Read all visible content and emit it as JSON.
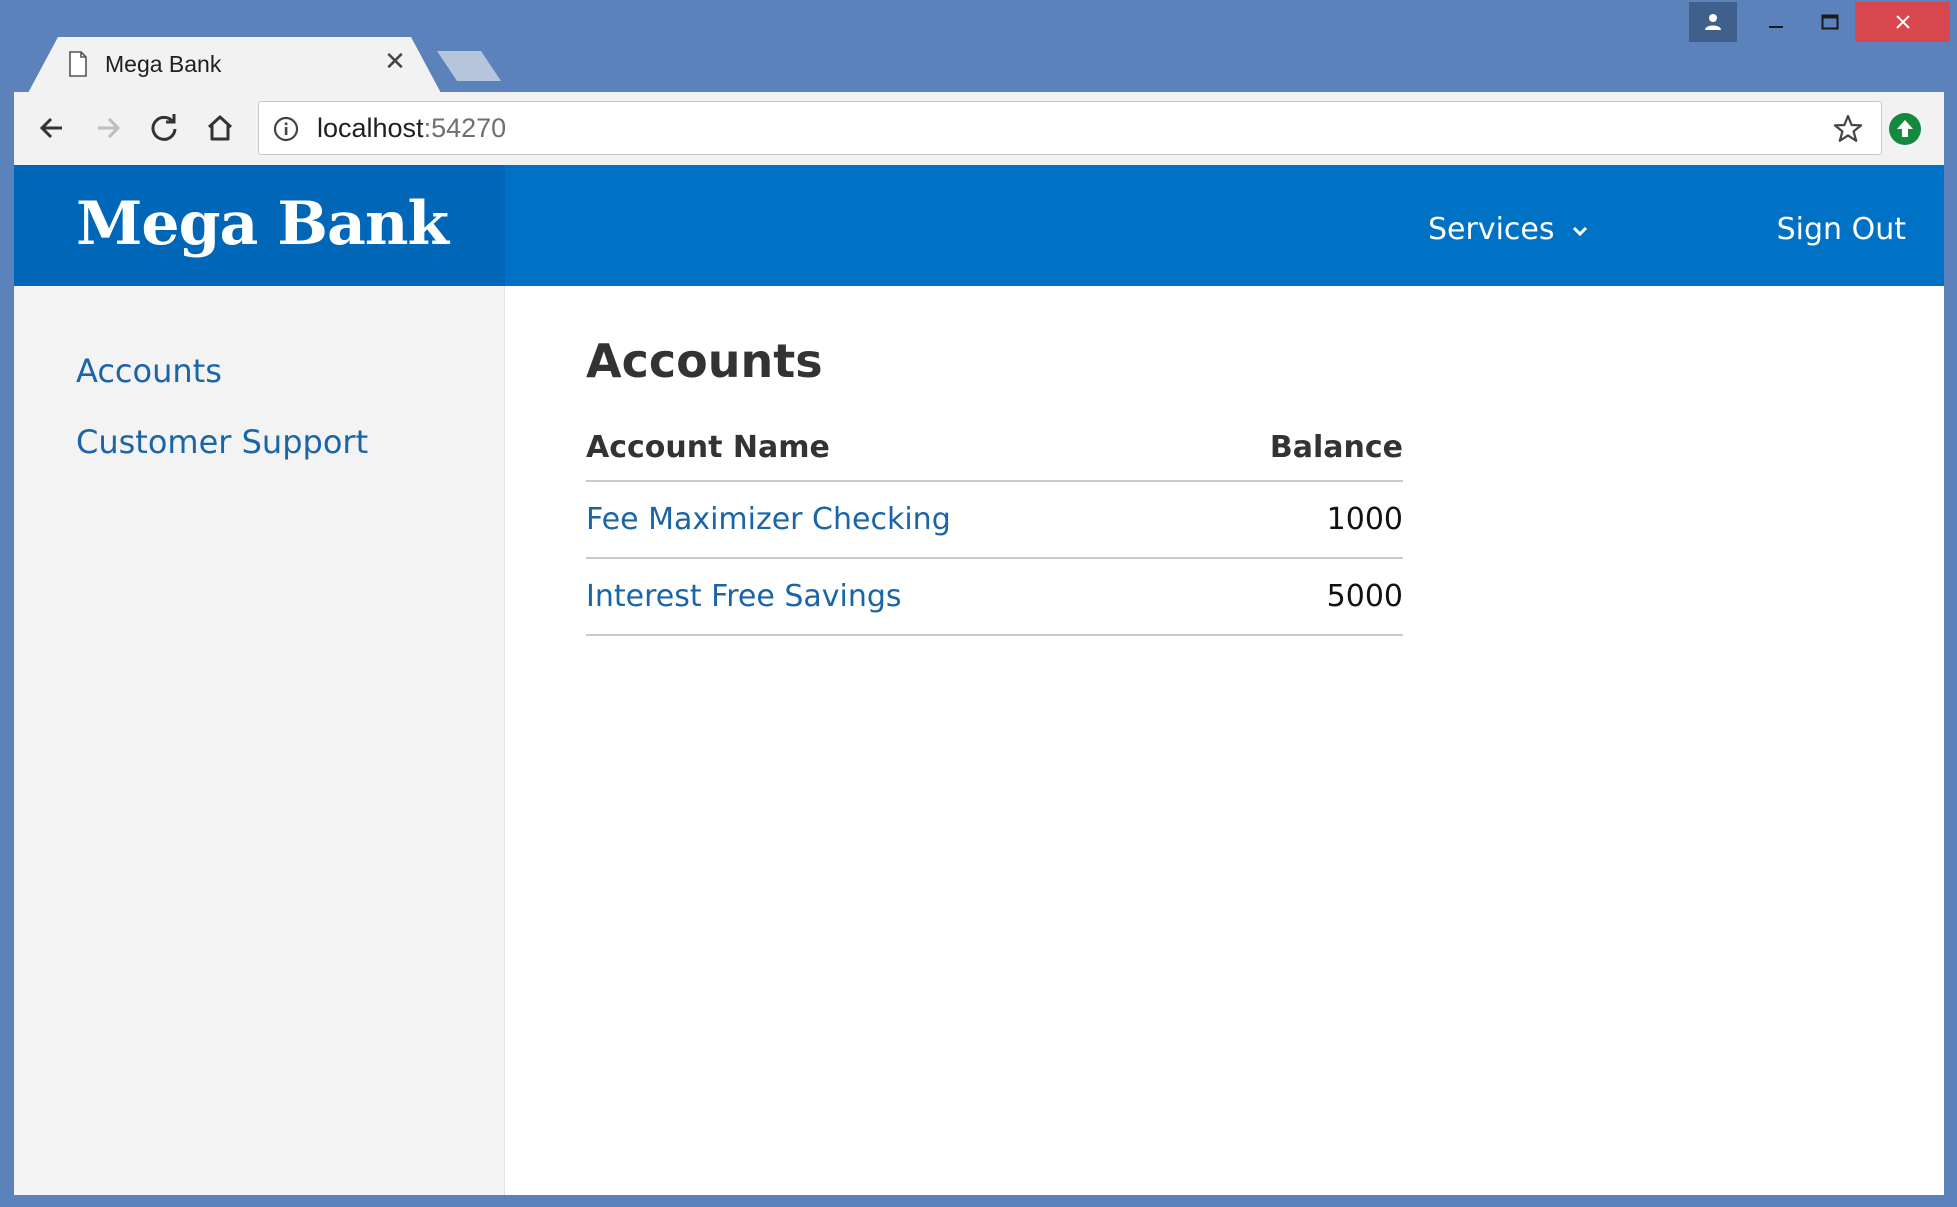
{
  "browser": {
    "tab_title": "Mega Bank",
    "tab_close_glyph": "✕",
    "url_host": "localhost",
    "url_port": ":54270"
  },
  "site": {
    "brand": "Mega Bank",
    "nav": {
      "services": "Services",
      "sign_out": "Sign Out"
    }
  },
  "sidebar": {
    "items": [
      {
        "label": "Accounts"
      },
      {
        "label": "Customer Support"
      }
    ]
  },
  "main": {
    "title": "Accounts",
    "table": {
      "headers": {
        "name": "Account Name",
        "balance": "Balance"
      },
      "rows": [
        {
          "name": "Fee Maximizer Checking",
          "balance": "1000"
        },
        {
          "name": "Interest Free Savings",
          "balance": "5000"
        }
      ]
    }
  },
  "colors": {
    "header_blue": "#0072c6",
    "brand_blue": "#0067b8",
    "link_blue": "#1a64a8",
    "window_frame": "#5b82bb",
    "close_red": "#d9474e"
  },
  "icons": [
    "file-icon",
    "close-icon",
    "person-icon",
    "minimize-icon",
    "maximize-icon",
    "window-close-icon",
    "back-arrow-icon",
    "forward-arrow-icon",
    "reload-icon",
    "home-icon",
    "info-icon",
    "star-icon",
    "update-icon",
    "chevron-down-icon"
  ]
}
